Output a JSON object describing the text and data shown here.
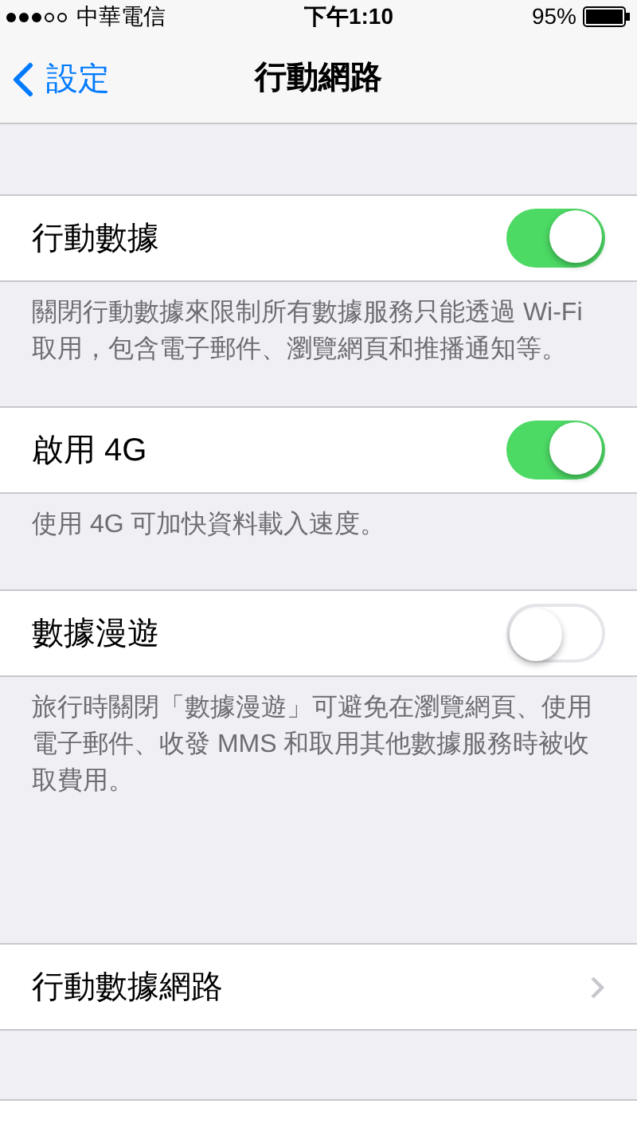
{
  "status_bar": {
    "carrier": "中華電信",
    "time": "下午1:10",
    "battery": "95%"
  },
  "nav": {
    "back": "設定",
    "title": "行動網路"
  },
  "sections": [
    {
      "rows": [
        {
          "kind": "toggle",
          "label": "行動數據",
          "on": true
        }
      ],
      "footer": "關閉行動數據來限制所有數據服務只能透過 Wi-Fi 取用，包含電子郵件、瀏覽網頁和推播通知等。"
    },
    {
      "rows": [
        {
          "kind": "toggle",
          "label": "啟用 4G",
          "on": true
        }
      ],
      "footer": "使用 4G 可加快資料載入速度。"
    },
    {
      "rows": [
        {
          "kind": "toggle",
          "label": "數據漫遊",
          "on": false
        }
      ],
      "footer": "旅行時關閉「數據漫遊」可避免在瀏覽網頁、使用電子郵件、收發 MMS 和取用其他數據服務時被收取費用。"
    },
    {
      "rows": [
        {
          "kind": "link",
          "label": "行動數據網路"
        }
      ]
    }
  ]
}
